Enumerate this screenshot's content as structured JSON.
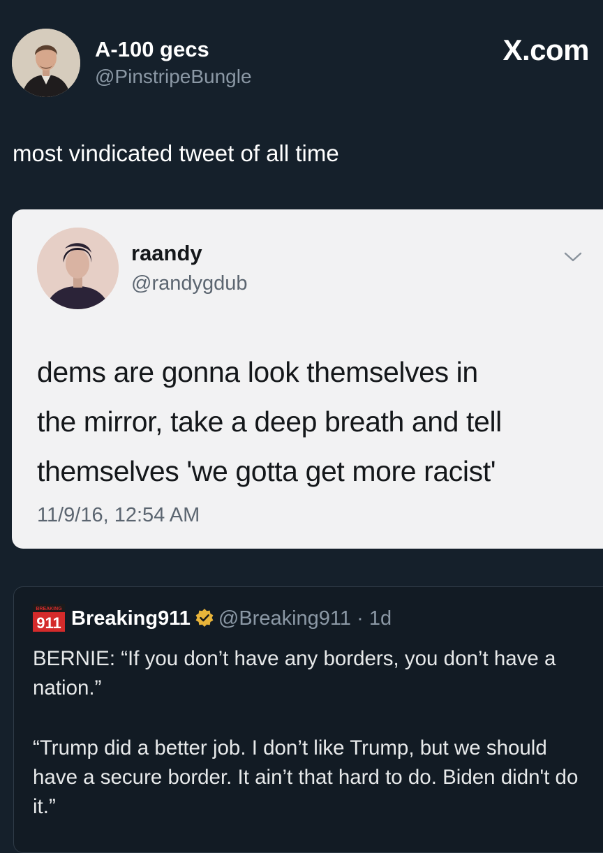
{
  "post": {
    "author_name": "A-100 gecs",
    "author_handle": "@PinstripeBungle",
    "brand": "X.com",
    "text": "most vindicated tweet of all time"
  },
  "embedded_tweet": {
    "name": "raandy",
    "handle": "@randygdub",
    "lines": [
      "dems are gonna look themselves in",
      "the mirror, take a deep breath and tell",
      "themselves 'we gotta get more racist'"
    ],
    "timestamp": "11/9/16, 12:54 AM"
  },
  "quoted_post": {
    "logo_small_text": "BREAKING",
    "logo_text": "911",
    "name": "Breaking911",
    "handle": "@Breaking911",
    "separator": "·",
    "age": "1d",
    "paragraphs": [
      "BERNIE: “If you don’t have any borders, you don’t have a nation.”",
      "“Trump did a better job. I don’t like Trump, but we should have a secure border. It ain’t that hard to do. Biden didn't do it.”"
    ]
  },
  "colors": {
    "background": "#15202b",
    "card_background": "#f2f2f3",
    "verified_badge": "#e8b43a",
    "logo_red": "#d42b2b"
  }
}
